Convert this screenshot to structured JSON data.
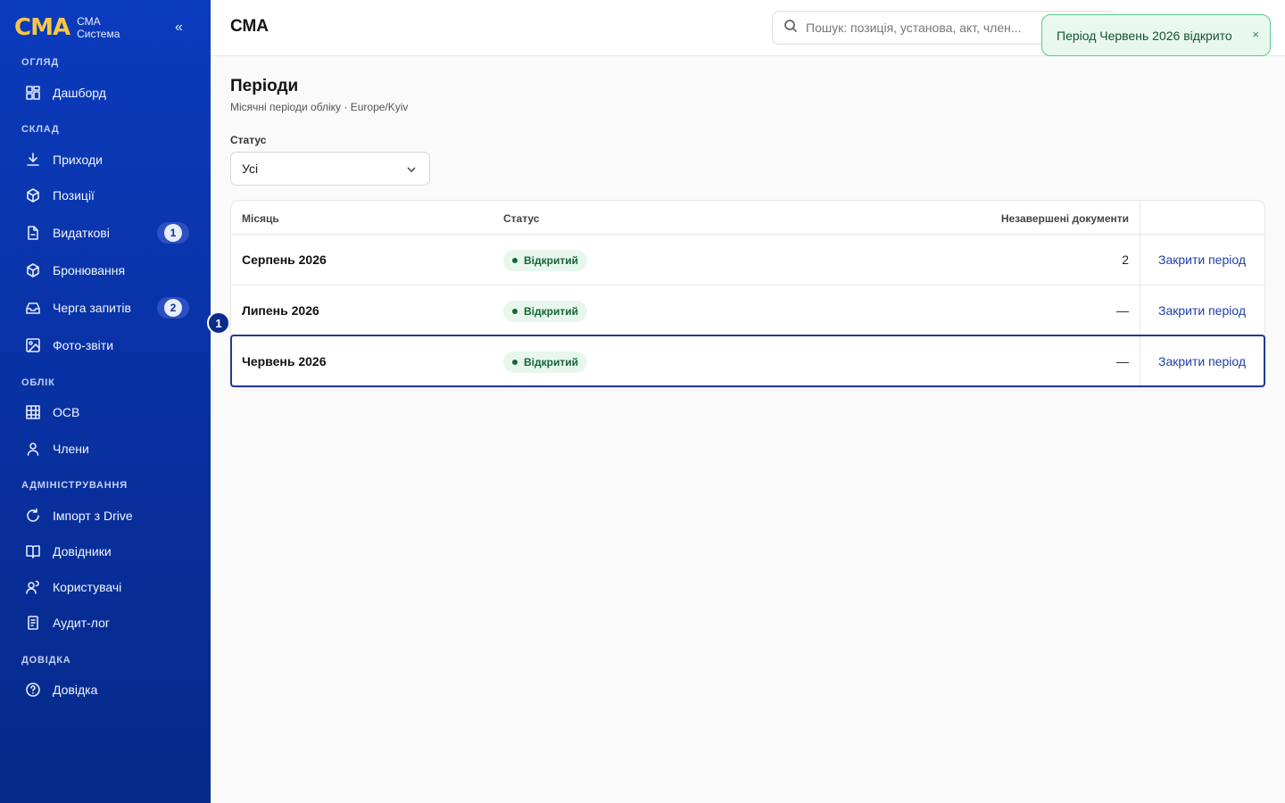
{
  "brand": {
    "logo": "СМА",
    "line1": "СМА",
    "line2": "Система",
    "collapse": "«"
  },
  "sidebar": {
    "sections": [
      {
        "title": "ОГЛЯД",
        "items": [
          {
            "label": "Дашборд",
            "icon": "dashboard-icon"
          }
        ]
      },
      {
        "title": "СКЛАД",
        "items": [
          {
            "label": "Приходи",
            "icon": "download-icon"
          },
          {
            "label": "Позиції",
            "icon": "box-icon"
          },
          {
            "label": "Видаткові",
            "icon": "document-icon",
            "badge": "1"
          },
          {
            "label": "Бронювання",
            "icon": "box-icon"
          },
          {
            "label": "Черга запитів",
            "icon": "inbox-icon",
            "badge": "2"
          },
          {
            "label": "Фото-звіти",
            "icon": "image-icon"
          }
        ]
      },
      {
        "title": "ОБЛІК",
        "items": [
          {
            "label": "ОСВ",
            "icon": "table-grid-icon"
          },
          {
            "label": "Члени",
            "icon": "user-icon"
          }
        ]
      },
      {
        "title": "АДМІНІСТРУВАННЯ",
        "items": [
          {
            "label": "Імпорт з Drive",
            "icon": "refresh-icon"
          },
          {
            "label": "Довідники",
            "icon": "book-icon"
          },
          {
            "label": "Користувачі",
            "icon": "users-icon"
          },
          {
            "label": "Аудит-лог",
            "icon": "clipboard-icon"
          }
        ]
      },
      {
        "title": "ДОВІДКА",
        "items": [
          {
            "label": "Довідка",
            "icon": "help-icon"
          }
        ]
      }
    ]
  },
  "topbar": {
    "title": "СМА",
    "search_placeholder": "Пошук: позиція, установа, акт, член..."
  },
  "toast": {
    "text": "Період Червень 2026 відкрито",
    "close": "×"
  },
  "page": {
    "title": "Періоди",
    "subtitle": "Місячні періоди обліку · Europe/Kyiv",
    "filter_label": "Статус",
    "filter_value": "Усі"
  },
  "table": {
    "headers": {
      "month": "Місяць",
      "status": "Статус",
      "pending": "Незавершені документи"
    },
    "rows": [
      {
        "month": "Серпень 2026",
        "status": "Відкритий",
        "pending": "2",
        "action": "Закрити період"
      },
      {
        "month": "Липень 2026",
        "status": "Відкритий",
        "pending": "—",
        "action": "Закрити період"
      },
      {
        "month": "Червень 2026",
        "status": "Відкритий",
        "pending": "—",
        "action": "Закрити період"
      }
    ]
  },
  "step_marker": "1",
  "colors": {
    "sidebar": "#0b3bbd",
    "brand": "#f6c744",
    "accent": "#1d3fa8",
    "success_bg": "#e7f7ee",
    "success_text": "#166534"
  }
}
